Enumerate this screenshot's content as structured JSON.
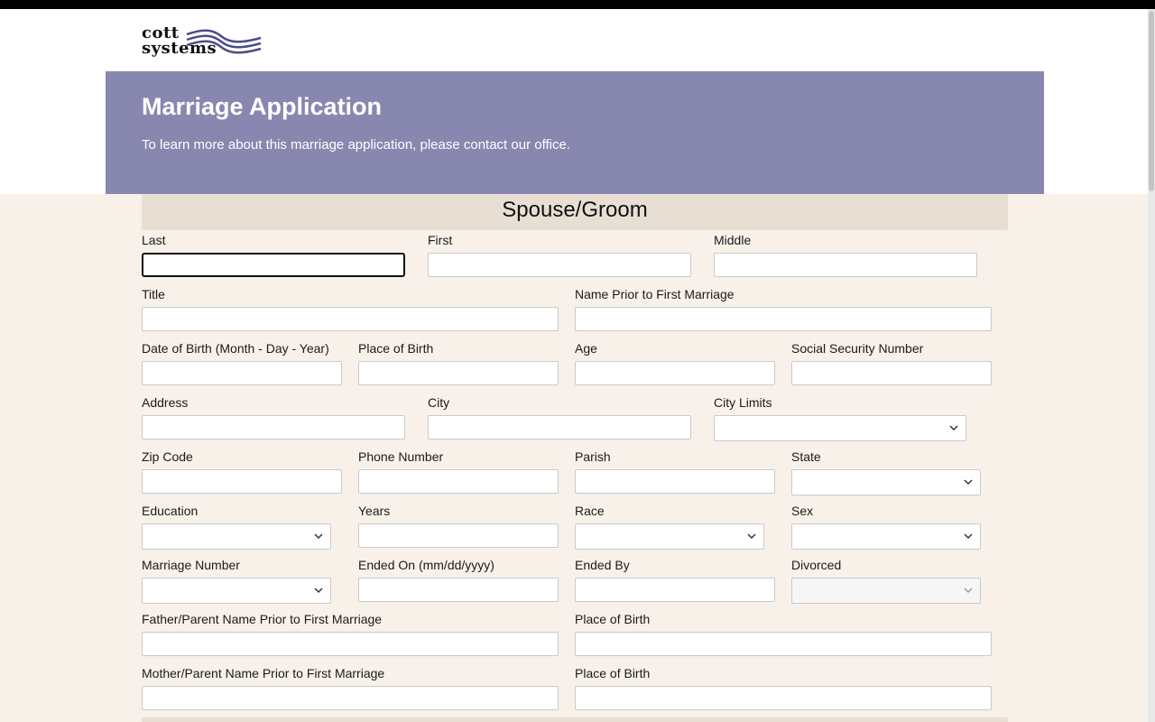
{
  "logo": {
    "line1": "cott",
    "line2": "systems"
  },
  "banner": {
    "title": "Marriage Application",
    "subtitle": "To learn more about this marriage application, please contact our office."
  },
  "section": {
    "title": "Spouse/Groom"
  },
  "fields": {
    "last": "Last",
    "first": "First",
    "middle": "Middle",
    "title": "Title",
    "name_prior": "Name Prior to First Marriage",
    "dob": "Date of Birth (Month - Day - Year)",
    "place_of_birth": "Place of Birth",
    "age": "Age",
    "ssn": "Social Security Number",
    "address": "Address",
    "city": "City",
    "city_limits": "City Limits",
    "zip": "Zip Code",
    "phone": "Phone Number",
    "parish": "Parish",
    "state": "State",
    "education": "Education",
    "years": "Years",
    "race": "Race",
    "sex": "Sex",
    "marriage_number": "Marriage Number",
    "ended_on": "Ended On (mm/dd/yyyy)",
    "ended_by": "Ended By",
    "divorced": "Divorced",
    "father_name": "Father/Parent Name Prior to First Marriage",
    "father_place_of_birth": "Place of Birth",
    "mother_name": "Mother/Parent Name Prior to First Marriage",
    "mother_place_of_birth": "Place of Birth"
  },
  "colors": {
    "banner": "#8787b0",
    "page_background": "#f8f1ea",
    "section_header": "#e8dfd4"
  }
}
